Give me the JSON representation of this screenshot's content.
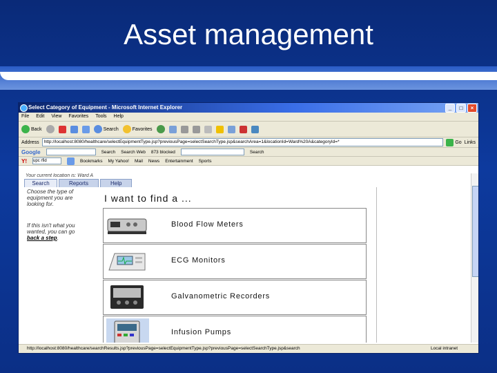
{
  "slide": {
    "title": "Asset management"
  },
  "browser": {
    "window_title": "Select Category of Equipment - Microsoft Internet Explorer",
    "menu": [
      "File",
      "Edit",
      "View",
      "Favorites",
      "Tools",
      "Help"
    ],
    "toolbar": {
      "back": "Back",
      "search": "Search",
      "favorites": "Favorites"
    },
    "address": {
      "label": "Address",
      "url": "http://localhost:8080/healthcare/selectEquipmentType.jsp?previousPage=selectSearchType.jsp&searchArea=1&locationId=Ward%20A&categoryId=*",
      "go": "Go",
      "links": "Links"
    },
    "google_bar": {
      "logo": "Google",
      "search": "Search",
      "search_web": "Search Web",
      "blocked": "873 blocked",
      "search2": "Search"
    },
    "yahoo_bar": {
      "logo": "Y!",
      "query": "upc rfid",
      "bookmarks": "Bookmarks",
      "my_yahoo": "My Yahoo!",
      "mail": "Mail",
      "news": "News",
      "entertainment": "Entertainment",
      "sports": "Sports"
    },
    "status": {
      "url": "http://localhost:8080/healthcare/searchResults.jsp?previousPage=selectEquipmentType.jsp?previousPage=selectSearchType.jsp&search",
      "zone": "Local intranet"
    }
  },
  "page": {
    "location_prefix": "Your current location is:",
    "location_value": "Ward A",
    "tabs": [
      "Search",
      "Reports",
      "Help"
    ],
    "sidebar_intro": "Choose the type of equipment you are looking for.",
    "sidebar_help_prefix": "If this isn't what you wanted, you can go ",
    "sidebar_back_link": "back a step",
    "heading": "I want to find a ...",
    "equipment": [
      {
        "label": "Blood Flow Meters"
      },
      {
        "label": "ECG Monitors"
      },
      {
        "label": "Galvanometric Recorders"
      },
      {
        "label": "Infusion Pumps"
      }
    ]
  }
}
